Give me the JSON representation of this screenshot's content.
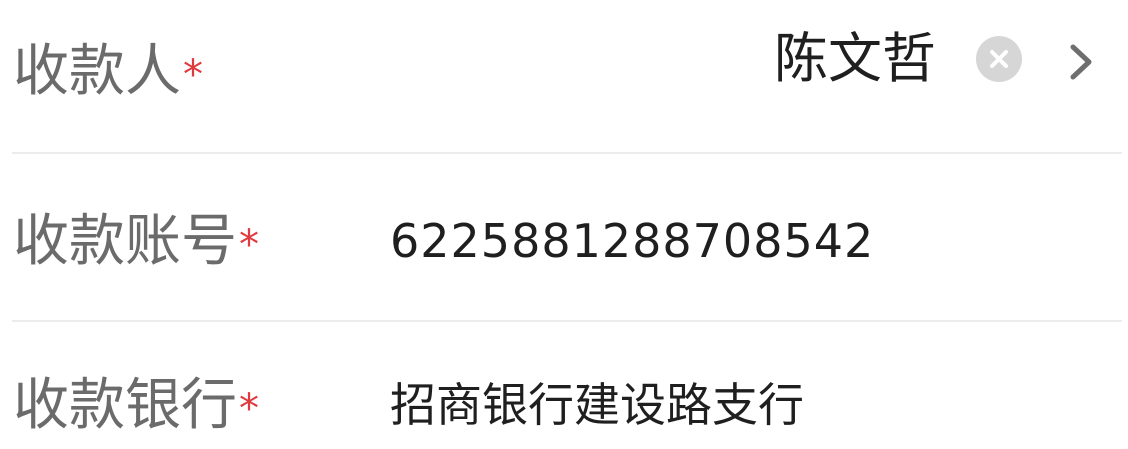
{
  "payee": {
    "label": "收款人",
    "required_mark": "*",
    "value": "陈文哲",
    "clear_icon": "clear-icon",
    "chevron_icon": "chevron-right-icon"
  },
  "account": {
    "label": "收款账号",
    "required_mark": "*",
    "value": "6225881288708542"
  },
  "bank": {
    "label": "收款银行",
    "required_mark": "*",
    "value": "招商银行建设路支行"
  },
  "colors": {
    "label": "#6b6b6b",
    "value": "#1f1f1f",
    "required": "#e0393e",
    "divider": "#ececec",
    "icon": "#d6d6d6"
  }
}
